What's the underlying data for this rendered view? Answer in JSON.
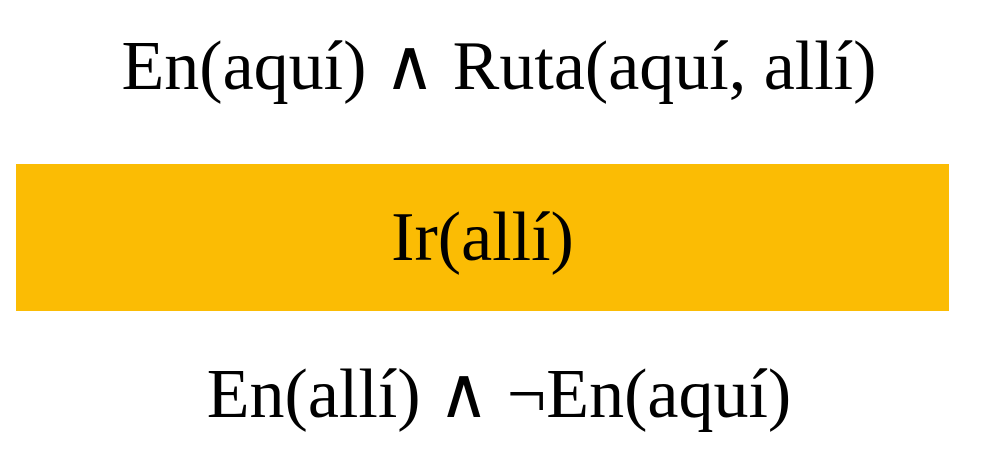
{
  "operator": {
    "preconditions": "En(aquí) ∧  Ruta(aquí, allí)",
    "action": "Ir(allí)",
    "effects": "En(allí) ∧ ¬En(aquí)"
  },
  "colors": {
    "action_box": "#FBBC04",
    "text": "#000000",
    "background": "#FFFFFF"
  }
}
